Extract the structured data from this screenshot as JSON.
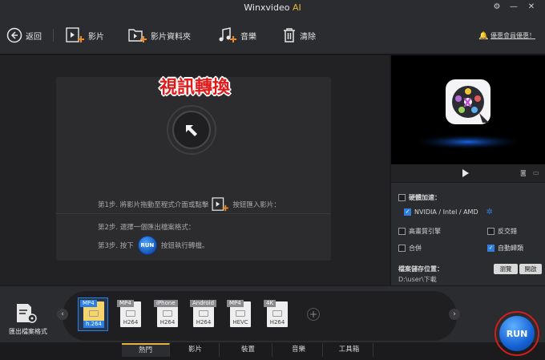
{
  "window": {
    "title": "Winxvideo",
    "title_suffix": "AI"
  },
  "toolbar": {
    "back_label": "返回",
    "video_label": "影片",
    "folder_label": "影片資料夾",
    "music_label": "音樂",
    "clear_label": "清除",
    "promo_label": "優惠會員優惠！"
  },
  "main": {
    "title": "視訊轉換",
    "step1_before": "第1步. 將影片拖動至程式介面或點擊",
    "step1_after": "按鈕匯入影片：",
    "step2": "第2步. 選擇一個匯出檔案格式：",
    "step3_before": "第3步. 按下",
    "step3_run": "RUN",
    "step3_after": "按鈕執行轉檔。"
  },
  "settings": {
    "hw_accel_label": "硬體加速：",
    "hw_accel_checked": false,
    "gpu_label": "NVIDIA / Intel / AMD",
    "gpu_checked": true,
    "hq_engine_label": "高畫質引擎",
    "hq_engine_checked": false,
    "deinterlace_label": "反交錯",
    "deinterlace_checked": false,
    "merge_label": "合併",
    "merge_checked": false,
    "auto_rename_label": "自動歸類",
    "auto_rename_checked": true,
    "output_folder_label": "檔案儲存位置：",
    "output_path": "D:\\user\\下載",
    "browse_label": "瀏覽",
    "open_label": "開啟"
  },
  "format_bar": {
    "output_label": "匯出檔案格式",
    "presets": [
      {
        "tag": "MP4",
        "codec": "h.264",
        "selected": true
      },
      {
        "tag": "MP4",
        "codec": "H264",
        "selected": false
      },
      {
        "tag": "iPhone",
        "codec": "H264",
        "selected": false
      },
      {
        "tag": "Android",
        "codec": "H264",
        "selected": false
      },
      {
        "tag": "MP4",
        "codec": "HEVC",
        "selected": false
      },
      {
        "tag": "4K",
        "codec": "H264",
        "selected": false
      }
    ]
  },
  "tabs": [
    {
      "label": "熱門",
      "active": true
    },
    {
      "label": "影片",
      "active": false
    },
    {
      "label": "裝置",
      "active": false
    },
    {
      "label": "音樂",
      "active": false
    },
    {
      "label": "工具箱",
      "active": false
    }
  ],
  "run_button": {
    "label": "RUN"
  },
  "colors": {
    "accent": "#2f7fe0",
    "brand": "#e8b33b",
    "warning": "#f08a24",
    "title_red": "#e01919"
  }
}
